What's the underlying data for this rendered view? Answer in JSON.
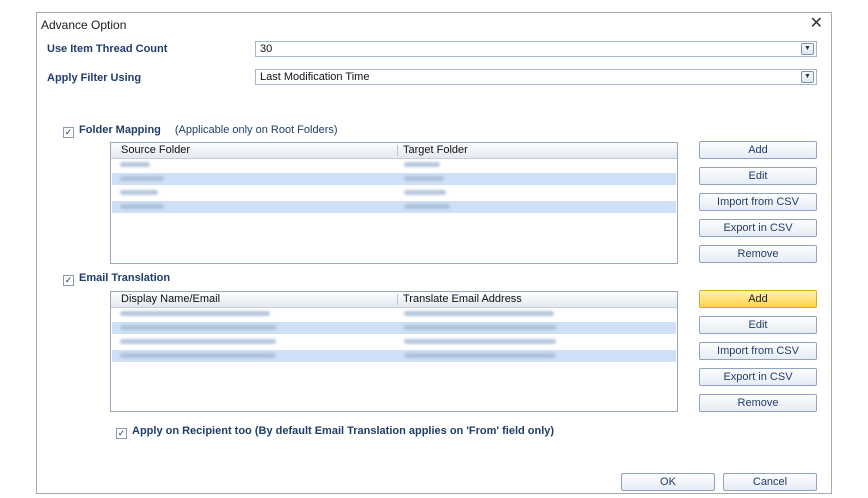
{
  "dialog": {
    "title": "Advance Option",
    "close_glyph": "✕"
  },
  "thread_count": {
    "label": "Use Item Thread Count",
    "value": "30"
  },
  "filter": {
    "label": "Apply Filter Using",
    "value": "Last Modification Time"
  },
  "folder_mapping": {
    "checked": true,
    "label": "Folder Mapping",
    "note": "(Applicable only on Root Folders)",
    "columns": [
      "Source Folder",
      "Target Folder"
    ],
    "rows": [
      {
        "source": "Inbox",
        "target": "Outbox"
      },
      {
        "source": "Sent Items",
        "target": "Journals"
      },
      {
        "source": "BhaktiS",
        "target": "PandeyG"
      },
      {
        "source": "Personal",
        "target": "Contacts"
      }
    ],
    "buttons": [
      "Add",
      "Edit",
      "Import from CSV",
      "Export in CSV",
      "Remove"
    ]
  },
  "email_translation": {
    "checked": true,
    "label": "Email Translation",
    "columns": [
      "Display Name/Email",
      "Translate Email Address"
    ],
    "rows": [
      {
        "display": "User@sourcedomain.com",
        "translate": "User4@targetdomain.com"
      },
      {
        "display": "User1@Sourcedomain.com",
        "translate": "User5@targetdomain.com"
      },
      {
        "display": "User2@Sourcedomain.com",
        "translate": "User6@Targetdomain.com"
      },
      {
        "display": "User3@Sourcedomain.com",
        "translate": "User7@Targetdomain.com"
      }
    ],
    "buttons": [
      "Add",
      "Edit",
      "Import from CSV",
      "Export in CSV",
      "Remove"
    ]
  },
  "apply_recipient": {
    "checked": true,
    "label": "Apply on Recipient too (By default Email Translation applies on 'From' field only)"
  },
  "footer": {
    "ok": "OK",
    "cancel": "Cancel"
  },
  "colors": {
    "label": "#1f3d6b",
    "row_highlight": "#cfe0f6",
    "button_active": "#ffd24a"
  }
}
